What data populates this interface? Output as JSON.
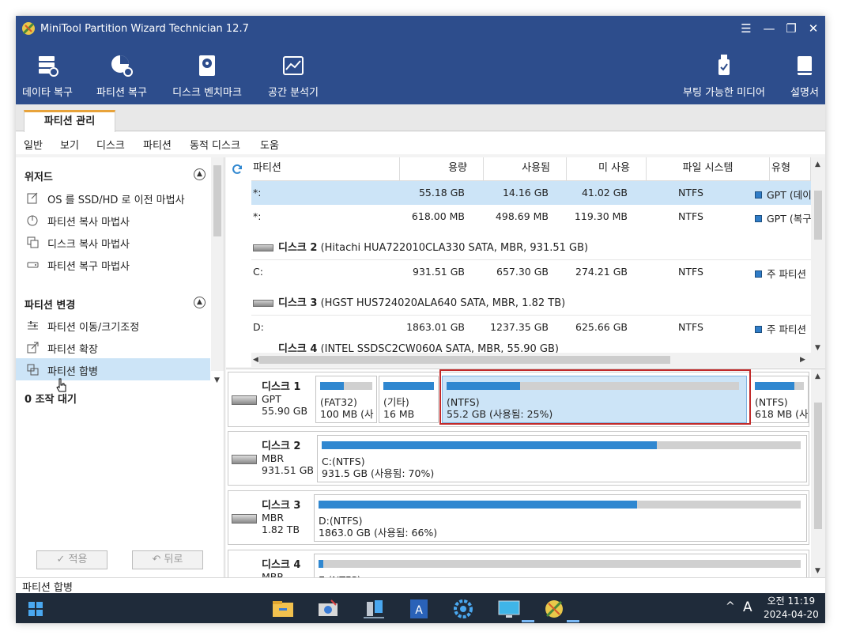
{
  "window": {
    "title": "MiniTool Partition Wizard Technician 12.7",
    "controls": [
      "☰",
      "—",
      "❐",
      "✕"
    ]
  },
  "toolbar": {
    "data_recovery": "데이타 복구",
    "partition_recovery": "파티션 복구",
    "disk_benchmark": "디스크 벤치마크",
    "space_analyzer": "공간 분석기",
    "bootable_media": "부팅 가능한 미디어",
    "manual": "설명서"
  },
  "tabs": {
    "partition_management": "파티션 관리"
  },
  "menu": {
    "general": "일반",
    "view": "보기",
    "disk": "디스크",
    "partition": "파티션",
    "dynamic_disk": "동적 디스크",
    "help": "도움"
  },
  "sidebar": {
    "wizard_header": "위저드",
    "wizard_items": [
      "OS 를 SSD/HD 로 이전 마법사",
      "파티션 복사 마법사",
      "디스크 복사 마법사",
      "파티션 복구 마법사"
    ],
    "change_header": "파티션 변경",
    "change_items": [
      "파티션 이동/크기조정",
      "파티션 확장",
      "파티션 합병"
    ],
    "pending": "0 조작 대기",
    "apply": "✓ 적용",
    "undo": "↶ 뒤로"
  },
  "table": {
    "columns": [
      "파티션",
      "용량",
      "사용됨",
      "미 사용",
      "파일 시스템",
      "유형"
    ],
    "rows": [
      {
        "partition": "*:",
        "capacity": "55.18 GB",
        "used": "14.16 GB",
        "unused": "41.02 GB",
        "fs": "NTFS",
        "type": "GPT (데이"
      },
      {
        "partition": "*:",
        "capacity": "618.00 MB",
        "used": "498.69 MB",
        "unused": "119.30 MB",
        "fs": "NTFS",
        "type": "GPT (복구"
      },
      {
        "partition": "C:",
        "capacity": "931.51 GB",
        "used": "657.30 GB",
        "unused": "274.21 GB",
        "fs": "NTFS",
        "type": "주 파티션"
      },
      {
        "partition": "D:",
        "capacity": "1863.01 GB",
        "used": "1237.35 GB",
        "unused": "625.66 GB",
        "fs": "NTFS",
        "type": "주 파티션"
      }
    ],
    "disk_rows": [
      {
        "name": "디스크 2",
        "detail": " (Hitachi HUA722010CLA330 SATA, MBR, 931.51 GB)"
      },
      {
        "name": "디스크 3",
        "detail": " (HGST HUS724020ALA640 SATA, MBR, 1.82 TB)"
      },
      {
        "name": "디스크 4",
        "detail": " (INTEL SSDSC2CW060A SATA, MBR, 55.90 GB)"
      }
    ]
  },
  "diskmap": {
    "disk1": {
      "name": "디스크 1",
      "style": "GPT",
      "size": "55.90 GB",
      "p1": {
        "l1": "(FAT32)",
        "l2": "100 MB (사",
        "used": 0.45
      },
      "p2": {
        "l1": "(기타)",
        "l2": "16 MB",
        "used": 1.0
      },
      "p3": {
        "l1": "(NTFS)",
        "l2": "55.2 GB (사용됨: 25%)",
        "used": 0.25
      },
      "p4": {
        "l1": "(NTFS)",
        "l2": "618 MB (사",
        "used": 0.8
      }
    },
    "disk2": {
      "name": "디스크 2",
      "style": "MBR",
      "size": "931.51 GB",
      "p1": {
        "l1": "C:(NTFS)",
        "l2": "931.5 GB (사용됨: 70%)",
        "used": 0.7
      }
    },
    "disk3": {
      "name": "디스크 3",
      "style": "MBR",
      "size": "1.82 TB",
      "p1": {
        "l1": "D:(NTFS)",
        "l2": "1863.0 GB (사용됨: 66%)",
        "used": 0.66
      }
    },
    "disk4": {
      "name": "디스크 4",
      "style": "MBR",
      "p1": {
        "l1": "E:(NTFS)",
        "used": 0.01
      }
    }
  },
  "status": {
    "text": "파티션 합병"
  },
  "taskbar": {
    "time": "오전 11:19",
    "date": "2024-04-20",
    "ime": "A",
    "tray_arrow": "^"
  },
  "colors": {
    "accent": "#2d4d8c",
    "bar_fill": "#2f87d0",
    "selection": "#cce4f7",
    "highlight_border": "#c12a2a"
  }
}
